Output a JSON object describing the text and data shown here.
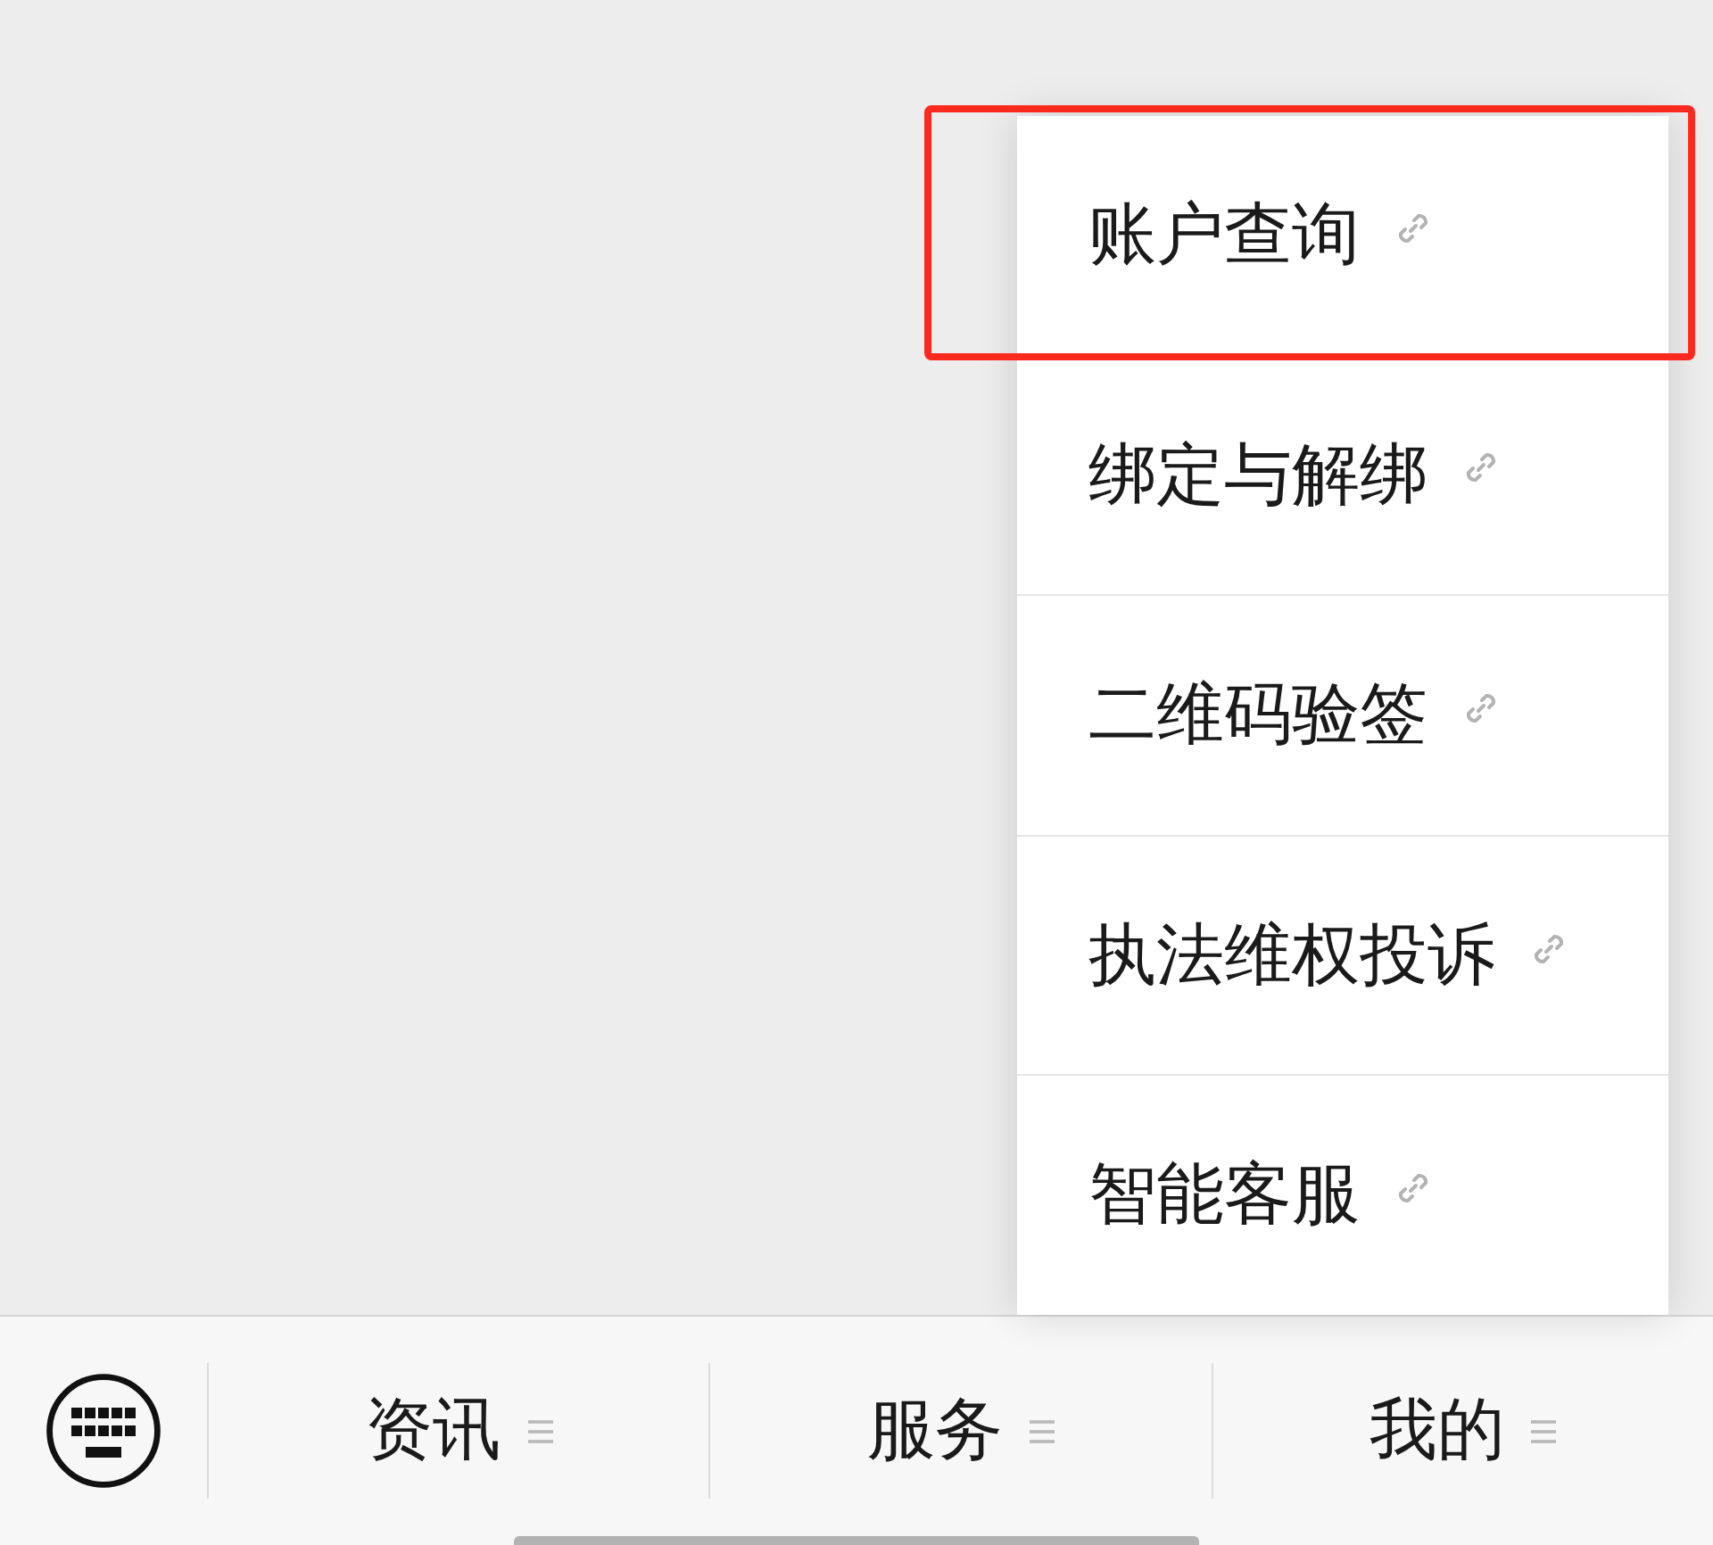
{
  "menu_popup": {
    "items": [
      {
        "label": "账户查询",
        "highlighted": true
      },
      {
        "label": "绑定与解绑",
        "highlighted": false
      },
      {
        "label": "二维码验签",
        "highlighted": false
      },
      {
        "label": "执法维权投诉",
        "highlighted": false
      },
      {
        "label": "智能客服",
        "highlighted": false
      }
    ]
  },
  "bottom_bar": {
    "tabs": [
      {
        "label": "资讯"
      },
      {
        "label": "服务"
      },
      {
        "label": "我的"
      }
    ]
  }
}
